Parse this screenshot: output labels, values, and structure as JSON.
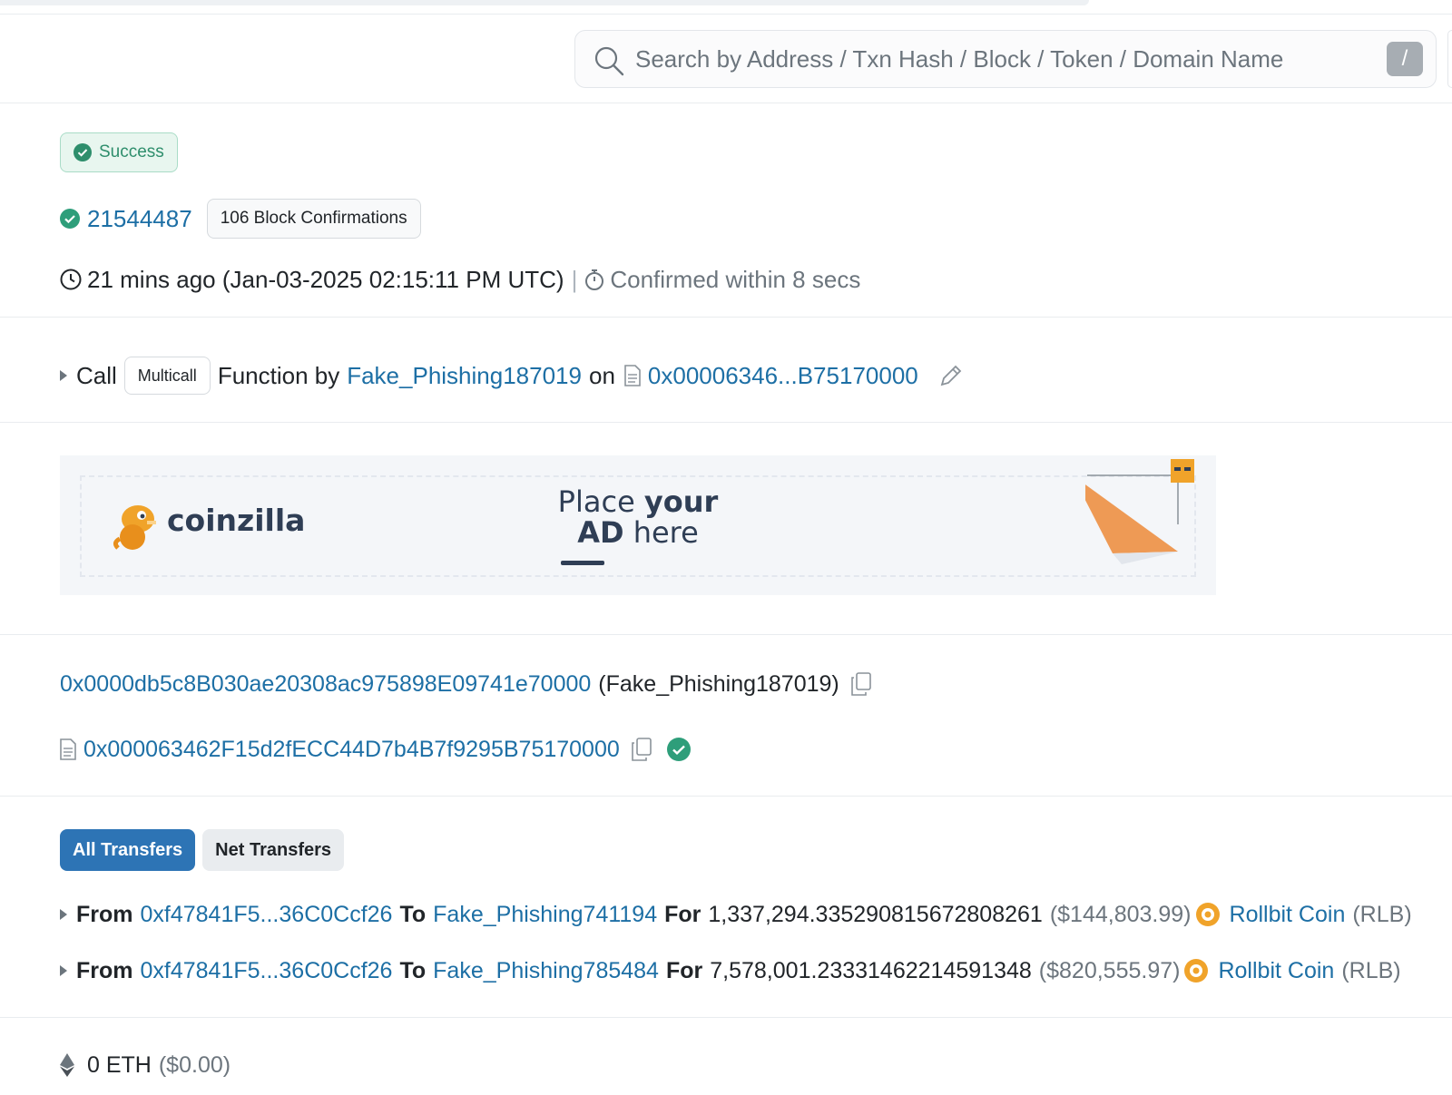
{
  "search": {
    "placeholder": "Search by Address / Txn Hash / Block / Token / Domain Name",
    "shortcut_key": "/"
  },
  "status": {
    "label": "Success",
    "color": "#2e8e6c"
  },
  "block": {
    "number": "21544487",
    "confirmations": "106 Block Confirmations"
  },
  "timestamp": {
    "text": "21 mins ago (Jan-03-2025 02:15:11 PM UTC)",
    "separator": "|",
    "confirmed": "Confirmed within 8 secs"
  },
  "call": {
    "word_call": "Call",
    "function_pill": "Multicall",
    "word_function_by": "Function by",
    "caller": "Fake_Phishing187019",
    "word_on": "on",
    "contract_short": "0x00006346...B75170000"
  },
  "ad": {
    "brand": "coinzilla",
    "line1_normal": "Place ",
    "line1_bold": "your",
    "line2_bold": "AD",
    "line2_normal": " here"
  },
  "from": {
    "address": "0x0000db5c8B030ae20308ac975898E09741e70000",
    "label": "(Fake_Phishing187019)"
  },
  "to": {
    "address": "0x000063462F15d2fECC44D7b4B7f9295B75170000"
  },
  "transfers_tabs": [
    {
      "label": "All Transfers",
      "active": true
    },
    {
      "label": "Net Transfers",
      "active": false
    }
  ],
  "transfers": [
    {
      "word_from": "From",
      "from": "0xf47841F5...36C0Ccf26",
      "word_to": "To",
      "to": "Fake_Phishing741194",
      "word_for": "For",
      "amount": "1,337,294.335290815672808261",
      "usd": "($144,803.99)",
      "token_name": "Rollbit Coin",
      "token_symbol": "(RLB)"
    },
    {
      "word_from": "From",
      "from": "0xf47841F5...36C0Ccf26",
      "word_to": "To",
      "to": "Fake_Phishing785484",
      "word_for": "For",
      "amount": "7,578,001.23331462214591348",
      "usd": "($820,555.97)",
      "token_name": "Rollbit Coin",
      "token_symbol": "(RLB)"
    }
  ],
  "value": {
    "eth": "0 ETH",
    "usd": "($0.00)"
  },
  "colors": {
    "link": "#1d6fa5",
    "accent": "#2d74b5",
    "coin": "#f0a32a"
  }
}
